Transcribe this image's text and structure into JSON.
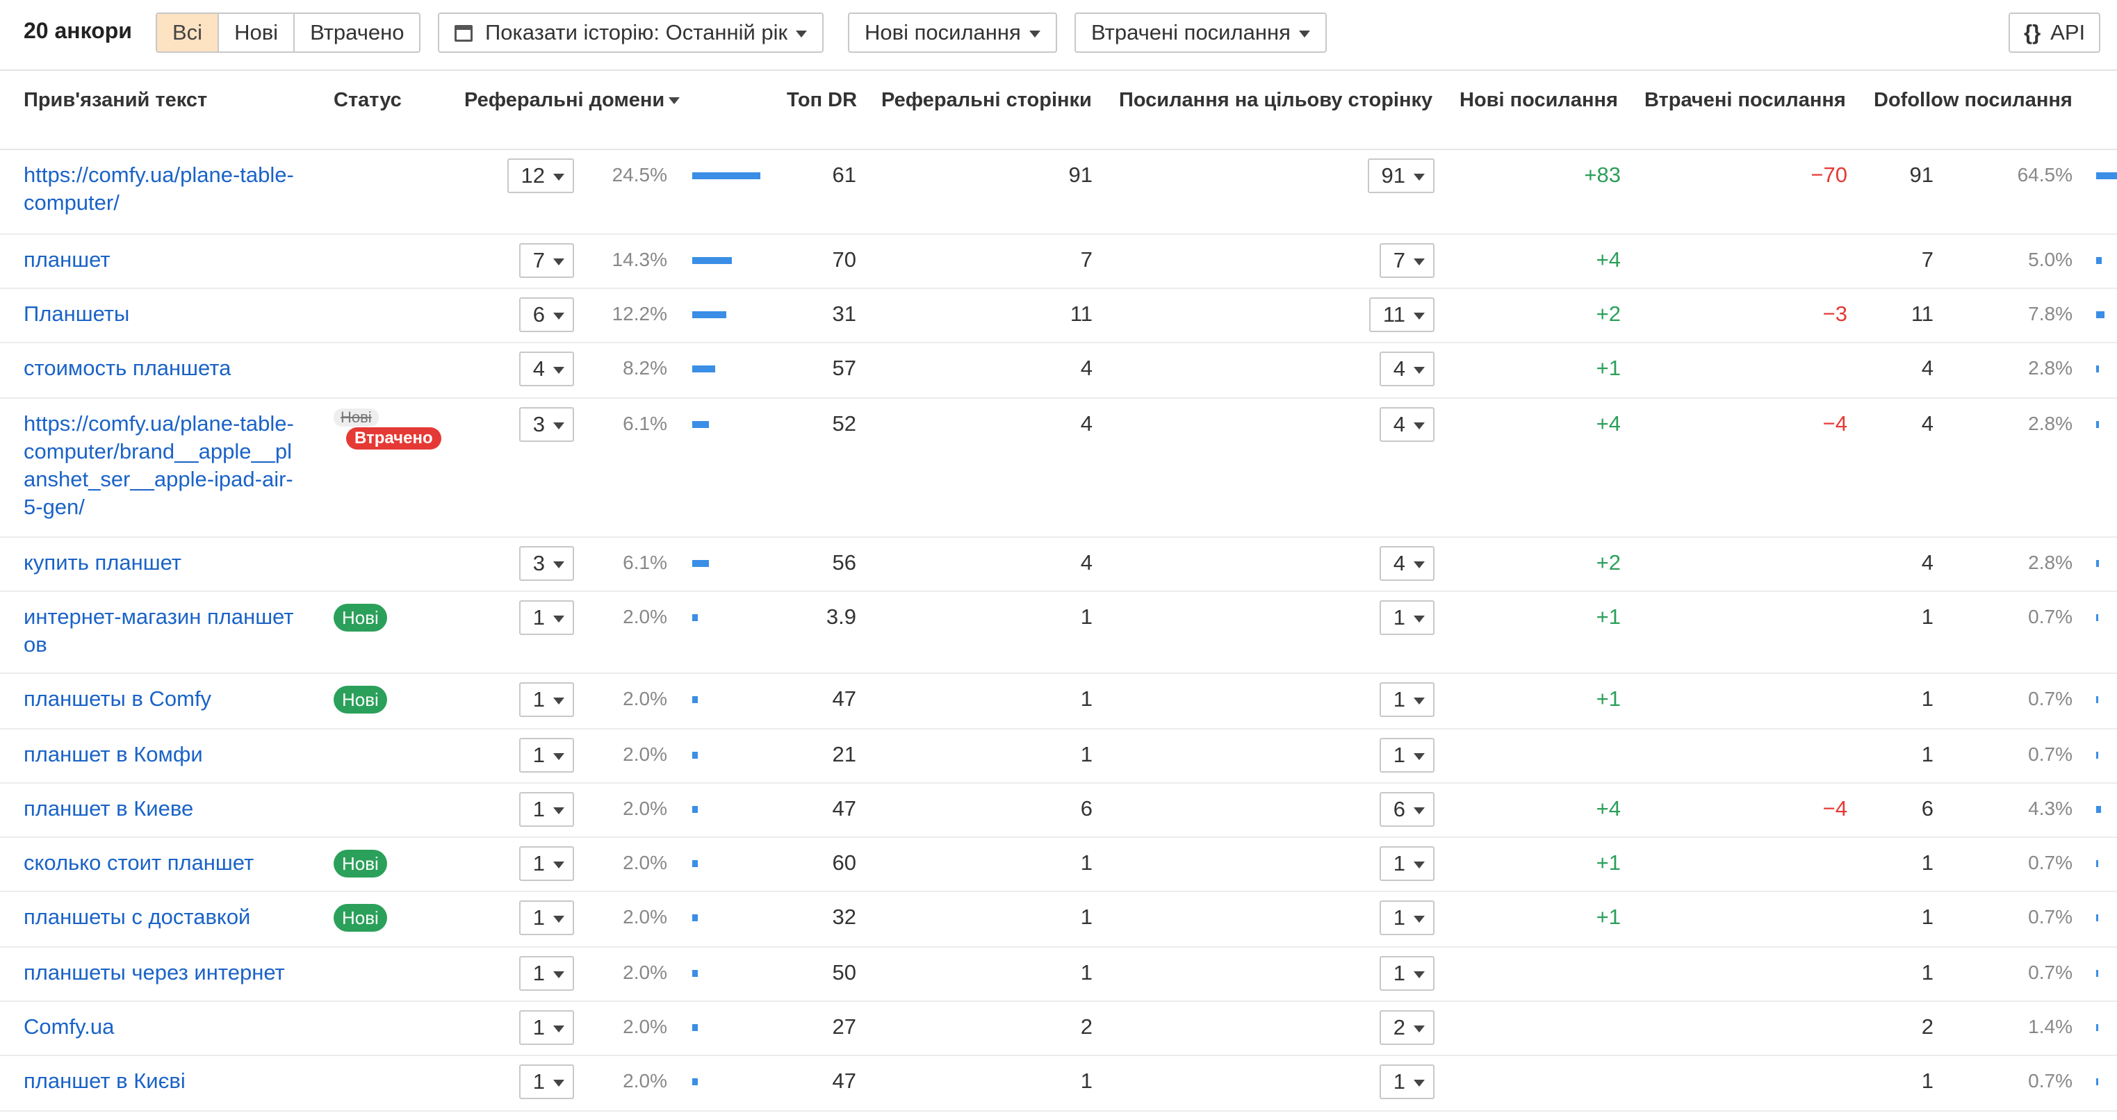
{
  "toolbar": {
    "title": "20 анкори",
    "filters": [
      "Всі",
      "Нові",
      "Втрачено"
    ],
    "history_label": "Показати історію: Останній рік",
    "new_links_label": "Нові посилання",
    "lost_links_label": "Втрачені посилання",
    "api_label": "API",
    "api_icon": "{}"
  },
  "columns": {
    "anchor": "Прив'язаний текст",
    "status": "Статус",
    "ref_domains": "Реферальні домени",
    "top_dr": "Топ DR",
    "ref_pages": "Реферальні сторінки",
    "links_to_target": "Посилання на цільову сторінку",
    "new_links": "Нові посилання",
    "lost_links": "Втрачені посилання",
    "dofollow": "Dofollow посилання"
  },
  "rows": [
    {
      "anchor": "https://comfy.ua/plane-table-computer/",
      "status": "",
      "domains": "12",
      "domains_pct": "24.5%",
      "domains_bar": 0.245,
      "dr": "61",
      "ref_pages": "91",
      "target_links": "91",
      "new": "+83",
      "lost": "−70",
      "dofollow": "91",
      "dofollow_pct": "64.5%",
      "dofollow_bar": 0.645
    },
    {
      "anchor": "планшет",
      "status": "",
      "domains": "7",
      "domains_pct": "14.3%",
      "domains_bar": 0.143,
      "dr": "70",
      "ref_pages": "7",
      "target_links": "7",
      "new": "+4",
      "lost": "",
      "dofollow": "7",
      "dofollow_pct": "5.0%",
      "dofollow_bar": 0.05
    },
    {
      "anchor": "Планшеты",
      "status": "",
      "domains": "6",
      "domains_pct": "12.2%",
      "domains_bar": 0.122,
      "dr": "31",
      "ref_pages": "11",
      "target_links": "11",
      "new": "+2",
      "lost": "−3",
      "dofollow": "11",
      "dofollow_pct": "7.8%",
      "dofollow_bar": 0.078
    },
    {
      "anchor": "стоимость планшета",
      "status": "",
      "domains": "4",
      "domains_pct": "8.2%",
      "domains_bar": 0.082,
      "dr": "57",
      "ref_pages": "4",
      "target_links": "4",
      "new": "+1",
      "lost": "",
      "dofollow": "4",
      "dofollow_pct": "2.8%",
      "dofollow_bar": 0.028
    },
    {
      "anchor": "https://comfy.ua/plane-table-computer/brand__apple__planshet_ser__apple-ipad-air-5-gen/",
      "status": "lost",
      "status_old": "Нові",
      "status_lost": "Втрачено",
      "domains": "3",
      "domains_pct": "6.1%",
      "domains_bar": 0.061,
      "dr": "52",
      "ref_pages": "4",
      "target_links": "4",
      "new": "+4",
      "lost": "−4",
      "dofollow": "4",
      "dofollow_pct": "2.8%",
      "dofollow_bar": 0.028
    },
    {
      "anchor": "купить планшет",
      "status": "",
      "domains": "3",
      "domains_pct": "6.1%",
      "domains_bar": 0.061,
      "dr": "56",
      "ref_pages": "4",
      "target_links": "4",
      "new": "+2",
      "lost": "",
      "dofollow": "4",
      "dofollow_pct": "2.8%",
      "dofollow_bar": 0.028
    },
    {
      "anchor": "интернет-магазин планшетов",
      "status": "new",
      "status_label": "Нові",
      "domains": "1",
      "domains_pct": "2.0%",
      "domains_bar": 0.02,
      "dr": "3.9",
      "ref_pages": "1",
      "target_links": "1",
      "new": "+1",
      "lost": "",
      "dofollow": "1",
      "dofollow_pct": "0.7%",
      "dofollow_bar": 0.007
    },
    {
      "anchor": "планшеты в Comfy",
      "status": "new",
      "status_label": "Нові",
      "domains": "1",
      "domains_pct": "2.0%",
      "domains_bar": 0.02,
      "dr": "47",
      "ref_pages": "1",
      "target_links": "1",
      "new": "+1",
      "lost": "",
      "dofollow": "1",
      "dofollow_pct": "0.7%",
      "dofollow_bar": 0.007
    },
    {
      "anchor": "планшет в Комфи",
      "status": "",
      "domains": "1",
      "domains_pct": "2.0%",
      "domains_bar": 0.02,
      "dr": "21",
      "ref_pages": "1",
      "target_links": "1",
      "new": "",
      "lost": "",
      "dofollow": "1",
      "dofollow_pct": "0.7%",
      "dofollow_bar": 0.007
    },
    {
      "anchor": "планшет в Киеве",
      "status": "",
      "domains": "1",
      "domains_pct": "2.0%",
      "domains_bar": 0.02,
      "dr": "47",
      "ref_pages": "6",
      "target_links": "6",
      "new": "+4",
      "lost": "−4",
      "dofollow": "6",
      "dofollow_pct": "4.3%",
      "dofollow_bar": 0.043
    },
    {
      "anchor": "сколько стоит планшет",
      "status": "new",
      "status_label": "Нові",
      "domains": "1",
      "domains_pct": "2.0%",
      "domains_bar": 0.02,
      "dr": "60",
      "ref_pages": "1",
      "target_links": "1",
      "new": "+1",
      "lost": "",
      "dofollow": "1",
      "dofollow_pct": "0.7%",
      "dofollow_bar": 0.007
    },
    {
      "anchor": "планшеты с доставкой",
      "status": "new",
      "status_label": "Нові",
      "domains": "1",
      "domains_pct": "2.0%",
      "domains_bar": 0.02,
      "dr": "32",
      "ref_pages": "1",
      "target_links": "1",
      "new": "+1",
      "lost": "",
      "dofollow": "1",
      "dofollow_pct": "0.7%",
      "dofollow_bar": 0.007
    },
    {
      "anchor": "планшеты через интернет",
      "status": "",
      "domains": "1",
      "domains_pct": "2.0%",
      "domains_bar": 0.02,
      "dr": "50",
      "ref_pages": "1",
      "target_links": "1",
      "new": "",
      "lost": "",
      "dofollow": "1",
      "dofollow_pct": "0.7%",
      "dofollow_bar": 0.007
    },
    {
      "anchor": "Comfy.ua",
      "status": "",
      "domains": "1",
      "domains_pct": "2.0%",
      "domains_bar": 0.02,
      "dr": "27",
      "ref_pages": "2",
      "target_links": "2",
      "new": "",
      "lost": "",
      "dofollow": "2",
      "dofollow_pct": "1.4%",
      "dofollow_bar": 0.014
    },
    {
      "anchor": "планшет в Києві",
      "status": "",
      "domains": "1",
      "domains_pct": "2.0%",
      "domains_bar": 0.02,
      "dr": "47",
      "ref_pages": "1",
      "target_links": "1",
      "new": "",
      "lost": "",
      "dofollow": "1",
      "dofollow_pct": "0.7%",
      "dofollow_bar": 0.007
    }
  ],
  "colors": {
    "accent": "#fde3c2",
    "link": "#1a63c7",
    "positive": "#2ba05a",
    "negative": "#e53935",
    "bar": "#3a8ee6"
  }
}
